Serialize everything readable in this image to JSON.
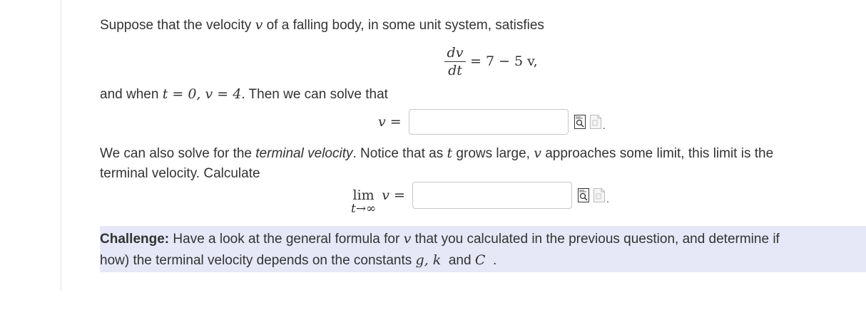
{
  "intro": {
    "text1": "Suppose that the velocity ",
    "var_v": "v",
    "text2": " of a falling body, in some unit system, satisfies"
  },
  "ode": {
    "numerator": "dv",
    "denominator": "dt",
    "rhs": "= 7 − 5 v,"
  },
  "initial": {
    "text1": "and when ",
    "math": "t = 0, v = 4",
    "text2": ". Then we can solve that"
  },
  "answer1": {
    "label": "v =",
    "value": ""
  },
  "terminal": {
    "text1": "We can also solve for the ",
    "emph": "terminal velocity",
    "text2": ". Notice that as ",
    "var_t": "t",
    "text3": " grows large, ",
    "var_v": "v",
    "text4": " approaches some limit, this limit is the",
    "line2": "terminal velocity. Calculate"
  },
  "answer2": {
    "lim": "lim",
    "lim_sub": "t→∞",
    "label": "v =",
    "value": ""
  },
  "icons": {
    "preview": "preview-icon",
    "help": "equation-help-icon"
  },
  "challenge": {
    "bold": "Challenge:",
    "text1": " Have a look at the general formula for ",
    "var_v": "v",
    "text2": " that you calculated in the previous question, and determine if",
    "line2_text1": "how) the terminal velocity depends on the constants ",
    "constants": "g, k",
    "line2_text2": "  and ",
    "var_C": "C",
    "line2_end": "  ."
  },
  "colors": {
    "challenge_bg": "#e6e8f7",
    "text": "#333333"
  }
}
